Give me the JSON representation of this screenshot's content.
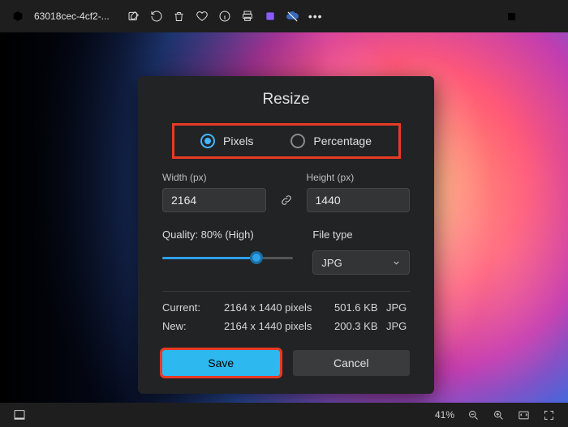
{
  "titlebar": {
    "filename": "63018cec-4cf2-..."
  },
  "dialog": {
    "title": "Resize",
    "radio_pixels": "Pixels",
    "radio_percentage": "Percentage",
    "width_label": "Width (px)",
    "height_label": "Height (px)",
    "width_value": "2164",
    "height_value": "1440",
    "quality_label": "Quality: 80% (High)",
    "filetype_label": "File type",
    "filetype_value": "JPG",
    "stats": {
      "current_label": "Current:",
      "new_label": "New:",
      "current_dims": "2164 x 1440 pixels",
      "new_dims": "2164 x 1440 pixels",
      "current_size": "501.6 KB",
      "new_size": "200.3 KB",
      "current_fmt": "JPG",
      "new_fmt": "JPG"
    },
    "save": "Save",
    "cancel": "Cancel"
  },
  "statusbar": {
    "zoom": "41%"
  }
}
